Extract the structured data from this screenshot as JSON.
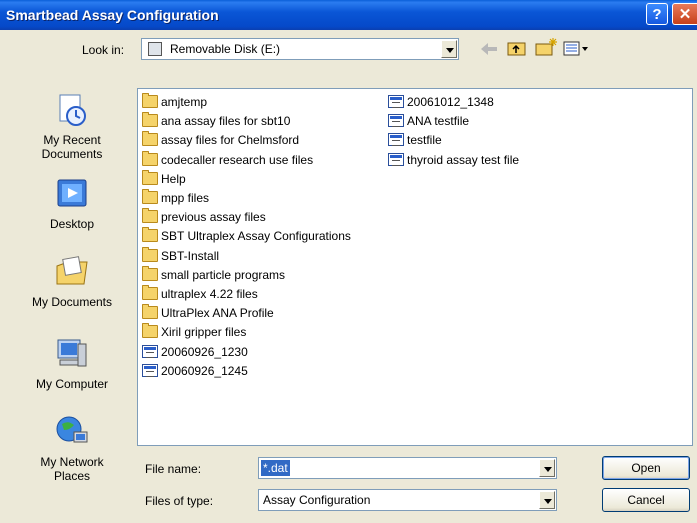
{
  "window": {
    "title": "Smartbead Assay Configuration",
    "help_glyph": "?",
    "close_glyph": "✕"
  },
  "lookin": {
    "label": "Look in:",
    "value": "Removable Disk (E:)"
  },
  "toolbar": {
    "back": "back-icon",
    "up": "up-folder-icon",
    "new_folder": "new-folder-icon",
    "views": "views-menu-icon"
  },
  "places": [
    {
      "label": "My Recent Documents",
      "icon": "recent-documents-icon"
    },
    {
      "label": "Desktop",
      "icon": "desktop-icon"
    },
    {
      "label": "My Documents",
      "icon": "my-documents-icon"
    },
    {
      "label": "My Computer",
      "icon": "my-computer-icon"
    },
    {
      "label": "My Network Places",
      "icon": "network-places-icon"
    }
  ],
  "files": {
    "col1": [
      {
        "name": "amjtemp",
        "type": "folder"
      },
      {
        "name": "ana assay files for sbt10",
        "type": "folder"
      },
      {
        "name": "assay files for Chelmsford",
        "type": "folder"
      },
      {
        "name": "codecaller research use files",
        "type": "folder"
      },
      {
        "name": "Help",
        "type": "folder"
      },
      {
        "name": "mpp files",
        "type": "folder"
      },
      {
        "name": "previous assay files",
        "type": "folder"
      },
      {
        "name": "SBT Ultraplex Assay Configurations",
        "type": "folder"
      },
      {
        "name": "SBT-Install",
        "type": "folder"
      },
      {
        "name": "small particle programs",
        "type": "folder"
      },
      {
        "name": "ultraplex 4.22 files",
        "type": "folder"
      },
      {
        "name": "UltraPlex ANA Profile",
        "type": "folder"
      },
      {
        "name": "Xiril gripper files",
        "type": "folder"
      },
      {
        "name": "20060926_1230",
        "type": "file"
      },
      {
        "name": "20060926_1245",
        "type": "file"
      }
    ],
    "col2": [
      {
        "name": "20061012_1348",
        "type": "file"
      },
      {
        "name": "ANA testfile",
        "type": "file"
      },
      {
        "name": "testfile",
        "type": "file"
      },
      {
        "name": "thyroid assay test file",
        "type": "file"
      }
    ]
  },
  "filename": {
    "label": "File name:",
    "value": "*.dat"
  },
  "filetype": {
    "label": "Files of type:",
    "value": "Assay Configuration"
  },
  "buttons": {
    "open": "Open",
    "cancel": "Cancel"
  }
}
